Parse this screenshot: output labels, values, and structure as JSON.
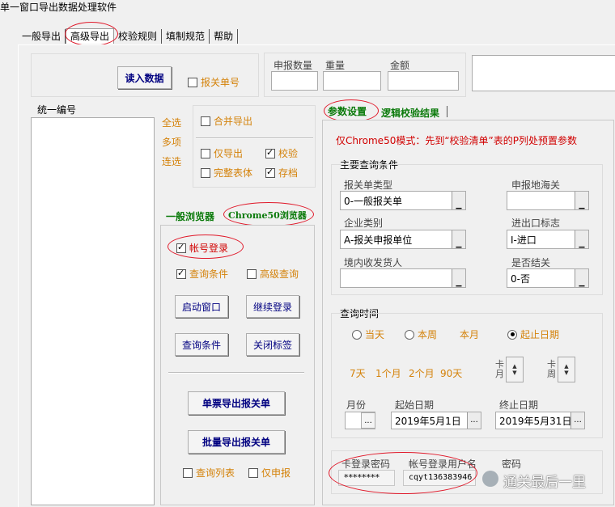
{
  "window": {
    "title": "单一窗口导出数据处理软件"
  },
  "tabs": [
    {
      "label": "一般导出"
    },
    {
      "label": "高级导出"
    },
    {
      "label": "校验规则"
    },
    {
      "label": "填制规范"
    },
    {
      "label": "帮助"
    }
  ],
  "top": {
    "read_button": "读入数据",
    "decl_no_checkbox": "报关单号",
    "count_label": "申报数量",
    "weight_label": "重量",
    "amount_label": "金额"
  },
  "left_list": {
    "header": "统一编号"
  },
  "select_links": {
    "all": "全选",
    "multi": "多项",
    "continuous": "连选"
  },
  "export_opts": {
    "merge": "合并导出",
    "only_export": "仅导出",
    "validate": "校验",
    "full_table": "完整表体",
    "archive": "存档"
  },
  "browser_tabs": {
    "normal": "一般浏览器",
    "chrome50": "Chrome50浏览器"
  },
  "browser": {
    "account_login": "帐号登录",
    "query_cond_cb": "查询条件",
    "adv_query_cb": "高级查询",
    "start_window": "启动窗口",
    "continue_login": "继续登录",
    "query_cond_btn": "查询条件",
    "close_tab": "关闭标签",
    "single_export": "单票导出报关单",
    "batch_export": "批量导出报关单",
    "query_list": "查询列表",
    "only_decl": "仅申报"
  },
  "right_tabs": {
    "params": "参数设置",
    "logic": "逻辑校验结果"
  },
  "params": {
    "notice": "仅Chrome50模式：先到“校验清单”表的P列处预置参数",
    "main_cond_title": "主要查询条件",
    "decl_type_label": "报关单类型",
    "decl_type_value": "0-一般报关单",
    "customs_label": "申报地海关",
    "customs_value": "",
    "ent_type_label": "企业类别",
    "ent_type_value": "A-报关申报单位",
    "ie_flag_label": "进出口标志",
    "ie_flag_value": "I-进口",
    "consignee_label": "境内收发货人",
    "consignee_value": "",
    "closed_label": "是否结关",
    "closed_value": "0-否",
    "dropdown_glyph": "▁",
    "time_title": "查询时间",
    "today": "当天",
    "this_week": "本周",
    "this_month": "本月",
    "date_range": "起止日期",
    "d7": "7天",
    "m1": "1个月",
    "m2": "2个月",
    "d90": "90天",
    "spin1_top": "卡",
    "spin1_bot": "月",
    "spin2_top": "卡",
    "spin2_bot": "周",
    "month_label": "月份",
    "start_label": "起始日期",
    "start_value": "2019年5月1日",
    "end_label": "终止日期",
    "end_value": "2019年5月31日",
    "ellipsis": "...",
    "card_pwd_label": "卡登录密码",
    "card_pwd_value": "********",
    "account_user_label": "帐号登录用户名",
    "account_user_value": "cqyt136383946",
    "pwd_label": "密码",
    "watermark": "通关最后一里"
  }
}
